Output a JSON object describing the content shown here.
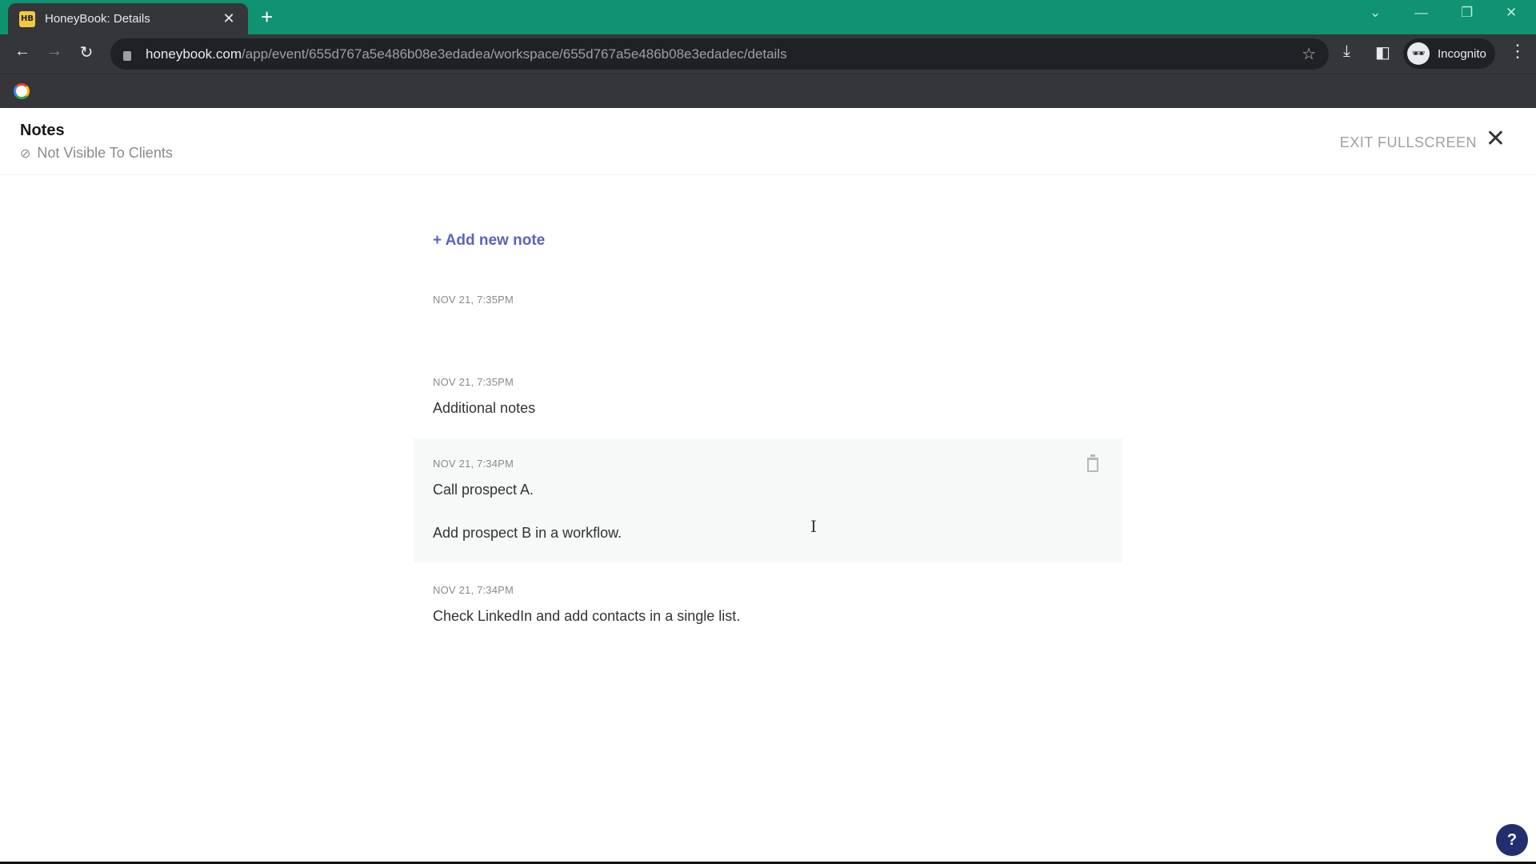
{
  "browser": {
    "tab_title": "HoneyBook: Details",
    "tab_favicon": "HB",
    "url_host": "honeybook.com",
    "url_path": "/app/event/655d767a5e486b08e3edadea/workspace/655d767a5e486b08e3edadec/details",
    "profile_label": "Incognito",
    "theme_color": "#0f9372"
  },
  "header": {
    "title": "Notes",
    "visibility_label": "Not Visible To Clients",
    "exit_fullscreen_label": "EXIT FULLSCREEN"
  },
  "notes": {
    "add_label": "+ Add new note",
    "accent_color": "#5b64b8",
    "items": [
      {
        "date": "NOV 21, 7:35PM",
        "text": ""
      },
      {
        "date": "NOV 21, 7:35PM",
        "text": "Additional notes"
      },
      {
        "date": "NOV 21, 7:34PM",
        "text": "Call prospect A.\n\nAdd prospect B in a workflow."
      },
      {
        "date": "NOV 21, 7:34PM",
        "text": "Check LinkedIn and add contacts in a single list."
      }
    ]
  },
  "help": {
    "label": "?"
  }
}
